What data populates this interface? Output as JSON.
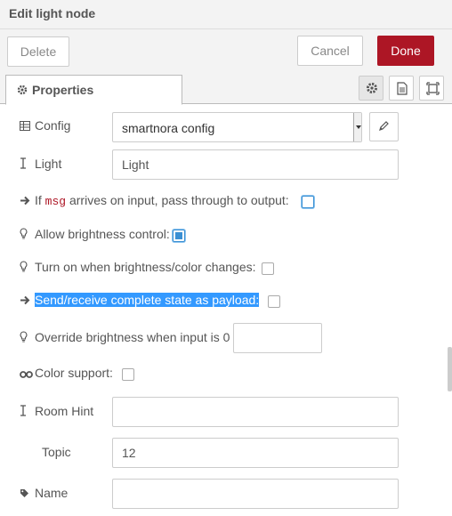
{
  "dialog": {
    "title": "Edit light node"
  },
  "toolbar": {
    "delete_label": "Delete",
    "cancel_label": "Cancel",
    "done_label": "Done"
  },
  "tabs": {
    "properties_label": "Properties"
  },
  "form": {
    "config": {
      "label": "Config",
      "value": "smartnora config"
    },
    "light": {
      "label": "Light",
      "value": "Light"
    },
    "passthrough": {
      "prefix": "If",
      "code": "msg",
      "suffix": "arrives on input, pass through to output:",
      "checked": false
    },
    "brightness": {
      "label": "Allow brightness control:",
      "checked": true
    },
    "turnon": {
      "label": "Turn on when brightness/color changes:",
      "checked": false
    },
    "complete_state": {
      "label": "Send/receive complete state as payload:",
      "checked": false
    },
    "override": {
      "label": "Override brightness when input is 0",
      "value": ""
    },
    "color": {
      "label": "Color support:",
      "checked": false
    },
    "room_hint": {
      "label": "Room Hint",
      "value": ""
    },
    "topic": {
      "label": "Topic",
      "value": "12"
    },
    "name": {
      "label": "Name",
      "value": ""
    }
  },
  "colors": {
    "done": "#ad1625",
    "highlight": "#3399ff",
    "accent": "#3a8fd3"
  },
  "icons": [
    "gear-icon",
    "file-icon",
    "frame-icon",
    "table-icon",
    "text-cursor-icon",
    "arrow-right-icon",
    "lightbulb-icon",
    "glasses-icon",
    "tag-icon",
    "pencil-icon"
  ]
}
